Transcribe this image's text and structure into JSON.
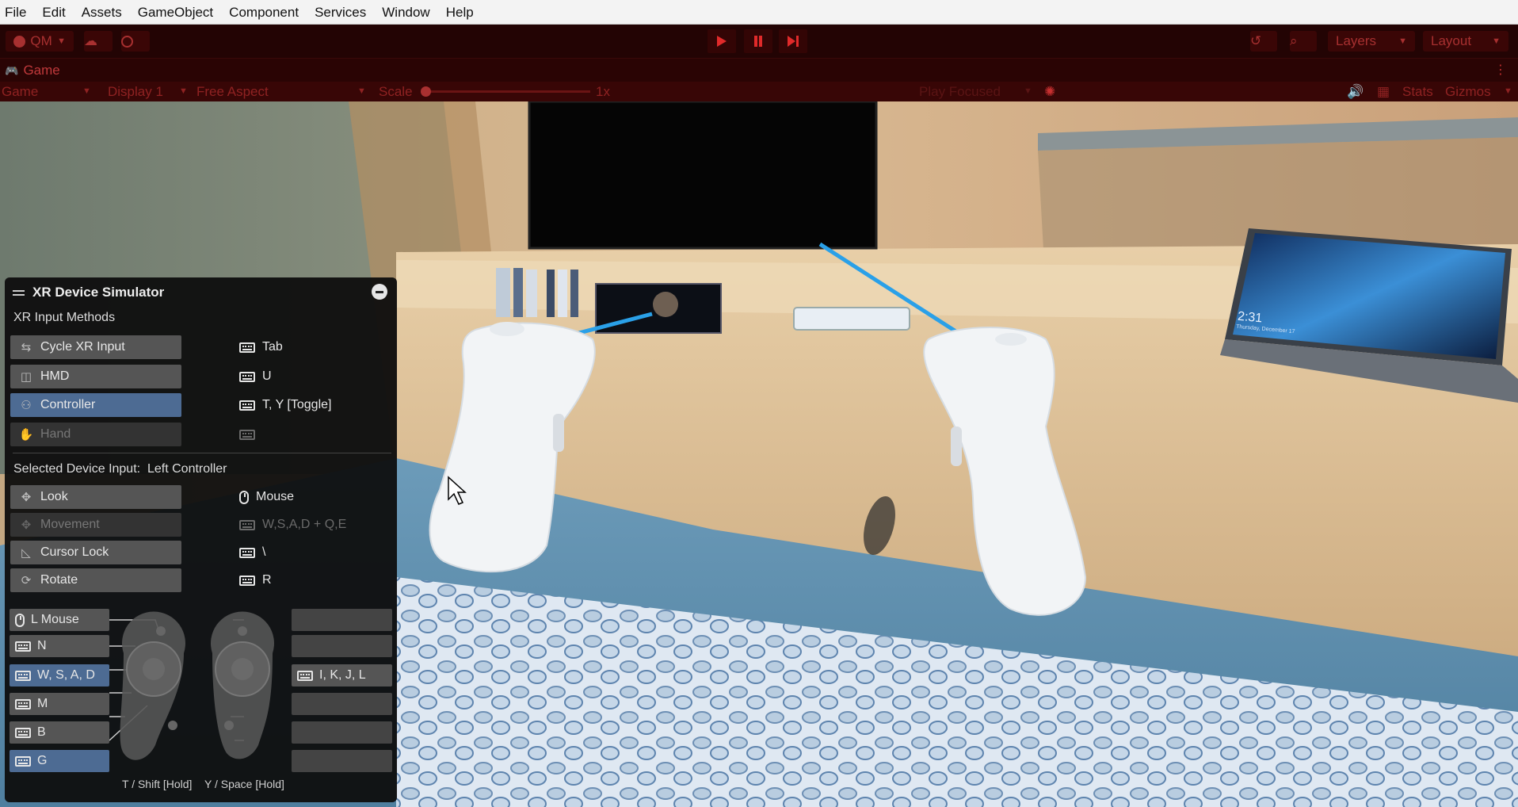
{
  "menu": [
    "File",
    "Edit",
    "Assets",
    "GameObject",
    "Component",
    "Services",
    "Window",
    "Help"
  ],
  "toolbar": {
    "account": "QM",
    "layers": "Layers",
    "layout": "Layout"
  },
  "game_tab": {
    "tab_label": "Game",
    "mode": "Game",
    "display": "Display 1",
    "aspect": "Free Aspect",
    "scale_label": "Scale",
    "scale_value": "1x",
    "play_focused": "Play Focused",
    "stats": "Stats",
    "gizmos": "Gizmos"
  },
  "scene": {
    "laptop_time": "2:31",
    "laptop_date": "Thursday, December 17"
  },
  "xr_sim": {
    "title": "XR Device Simulator",
    "input_methods_heading": "XR Input Methods",
    "input_methods": [
      {
        "label": "Cycle XR Input",
        "key": "Tab"
      },
      {
        "label": "HMD",
        "key": "U"
      },
      {
        "label": "Controller",
        "key": "T, Y [Toggle]"
      },
      {
        "label": "Hand",
        "key": ""
      }
    ],
    "selected_prefix": "Selected Device Input:",
    "selected_device": "Left Controller",
    "device_inputs": [
      {
        "label": "Look",
        "key": "Mouse"
      },
      {
        "label": "Movement",
        "key": "W,S,A,D + Q,E"
      },
      {
        "label": "Cursor Lock",
        "key": "\\"
      },
      {
        "label": "Rotate",
        "key": "R"
      }
    ],
    "controller_left": [
      "L Mouse",
      "N",
      "W, S, A, D",
      "M",
      "B",
      "G"
    ],
    "controller_right": [
      "",
      "",
      "I, K, J, L",
      "",
      "",
      ""
    ],
    "caption_t": "T / Shift [Hold]",
    "caption_y": "Y / Space [Hold]"
  },
  "colors": {
    "playmode_tint": "#2a0404",
    "selected_button": "#4d6b93",
    "beam": "#2aa0e8"
  }
}
